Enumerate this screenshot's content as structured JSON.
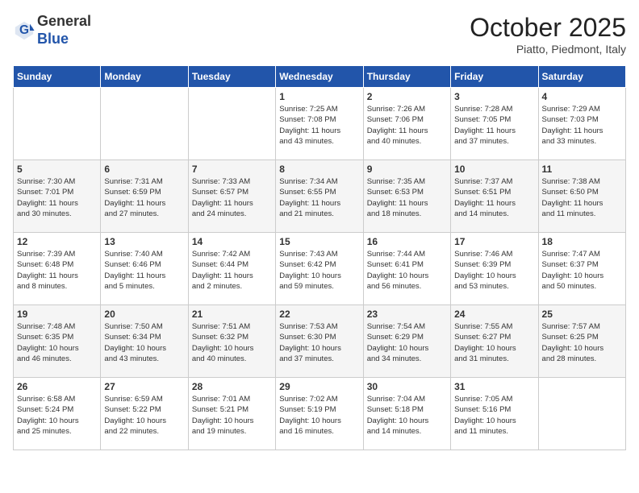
{
  "header": {
    "logo_general": "General",
    "logo_blue": "Blue",
    "month_title": "October 2025",
    "location": "Piatto, Piedmont, Italy"
  },
  "days_of_week": [
    "Sunday",
    "Monday",
    "Tuesday",
    "Wednesday",
    "Thursday",
    "Friday",
    "Saturday"
  ],
  "weeks": [
    [
      {
        "day": "",
        "info": ""
      },
      {
        "day": "",
        "info": ""
      },
      {
        "day": "",
        "info": ""
      },
      {
        "day": "1",
        "info": "Sunrise: 7:25 AM\nSunset: 7:08 PM\nDaylight: 11 hours\nand 43 minutes."
      },
      {
        "day": "2",
        "info": "Sunrise: 7:26 AM\nSunset: 7:06 PM\nDaylight: 11 hours\nand 40 minutes."
      },
      {
        "day": "3",
        "info": "Sunrise: 7:28 AM\nSunset: 7:05 PM\nDaylight: 11 hours\nand 37 minutes."
      },
      {
        "day": "4",
        "info": "Sunrise: 7:29 AM\nSunset: 7:03 PM\nDaylight: 11 hours\nand 33 minutes."
      }
    ],
    [
      {
        "day": "5",
        "info": "Sunrise: 7:30 AM\nSunset: 7:01 PM\nDaylight: 11 hours\nand 30 minutes."
      },
      {
        "day": "6",
        "info": "Sunrise: 7:31 AM\nSunset: 6:59 PM\nDaylight: 11 hours\nand 27 minutes."
      },
      {
        "day": "7",
        "info": "Sunrise: 7:33 AM\nSunset: 6:57 PM\nDaylight: 11 hours\nand 24 minutes."
      },
      {
        "day": "8",
        "info": "Sunrise: 7:34 AM\nSunset: 6:55 PM\nDaylight: 11 hours\nand 21 minutes."
      },
      {
        "day": "9",
        "info": "Sunrise: 7:35 AM\nSunset: 6:53 PM\nDaylight: 11 hours\nand 18 minutes."
      },
      {
        "day": "10",
        "info": "Sunrise: 7:37 AM\nSunset: 6:51 PM\nDaylight: 11 hours\nand 14 minutes."
      },
      {
        "day": "11",
        "info": "Sunrise: 7:38 AM\nSunset: 6:50 PM\nDaylight: 11 hours\nand 11 minutes."
      }
    ],
    [
      {
        "day": "12",
        "info": "Sunrise: 7:39 AM\nSunset: 6:48 PM\nDaylight: 11 hours\nand 8 minutes."
      },
      {
        "day": "13",
        "info": "Sunrise: 7:40 AM\nSunset: 6:46 PM\nDaylight: 11 hours\nand 5 minutes."
      },
      {
        "day": "14",
        "info": "Sunrise: 7:42 AM\nSunset: 6:44 PM\nDaylight: 11 hours\nand 2 minutes."
      },
      {
        "day": "15",
        "info": "Sunrise: 7:43 AM\nSunset: 6:42 PM\nDaylight: 10 hours\nand 59 minutes."
      },
      {
        "day": "16",
        "info": "Sunrise: 7:44 AM\nSunset: 6:41 PM\nDaylight: 10 hours\nand 56 minutes."
      },
      {
        "day": "17",
        "info": "Sunrise: 7:46 AM\nSunset: 6:39 PM\nDaylight: 10 hours\nand 53 minutes."
      },
      {
        "day": "18",
        "info": "Sunrise: 7:47 AM\nSunset: 6:37 PM\nDaylight: 10 hours\nand 50 minutes."
      }
    ],
    [
      {
        "day": "19",
        "info": "Sunrise: 7:48 AM\nSunset: 6:35 PM\nDaylight: 10 hours\nand 46 minutes."
      },
      {
        "day": "20",
        "info": "Sunrise: 7:50 AM\nSunset: 6:34 PM\nDaylight: 10 hours\nand 43 minutes."
      },
      {
        "day": "21",
        "info": "Sunrise: 7:51 AM\nSunset: 6:32 PM\nDaylight: 10 hours\nand 40 minutes."
      },
      {
        "day": "22",
        "info": "Sunrise: 7:53 AM\nSunset: 6:30 PM\nDaylight: 10 hours\nand 37 minutes."
      },
      {
        "day": "23",
        "info": "Sunrise: 7:54 AM\nSunset: 6:29 PM\nDaylight: 10 hours\nand 34 minutes."
      },
      {
        "day": "24",
        "info": "Sunrise: 7:55 AM\nSunset: 6:27 PM\nDaylight: 10 hours\nand 31 minutes."
      },
      {
        "day": "25",
        "info": "Sunrise: 7:57 AM\nSunset: 6:25 PM\nDaylight: 10 hours\nand 28 minutes."
      }
    ],
    [
      {
        "day": "26",
        "info": "Sunrise: 6:58 AM\nSunset: 5:24 PM\nDaylight: 10 hours\nand 25 minutes."
      },
      {
        "day": "27",
        "info": "Sunrise: 6:59 AM\nSunset: 5:22 PM\nDaylight: 10 hours\nand 22 minutes."
      },
      {
        "day": "28",
        "info": "Sunrise: 7:01 AM\nSunset: 5:21 PM\nDaylight: 10 hours\nand 19 minutes."
      },
      {
        "day": "29",
        "info": "Sunrise: 7:02 AM\nSunset: 5:19 PM\nDaylight: 10 hours\nand 16 minutes."
      },
      {
        "day": "30",
        "info": "Sunrise: 7:04 AM\nSunset: 5:18 PM\nDaylight: 10 hours\nand 14 minutes."
      },
      {
        "day": "31",
        "info": "Sunrise: 7:05 AM\nSunset: 5:16 PM\nDaylight: 10 hours\nand 11 minutes."
      },
      {
        "day": "",
        "info": ""
      }
    ]
  ]
}
